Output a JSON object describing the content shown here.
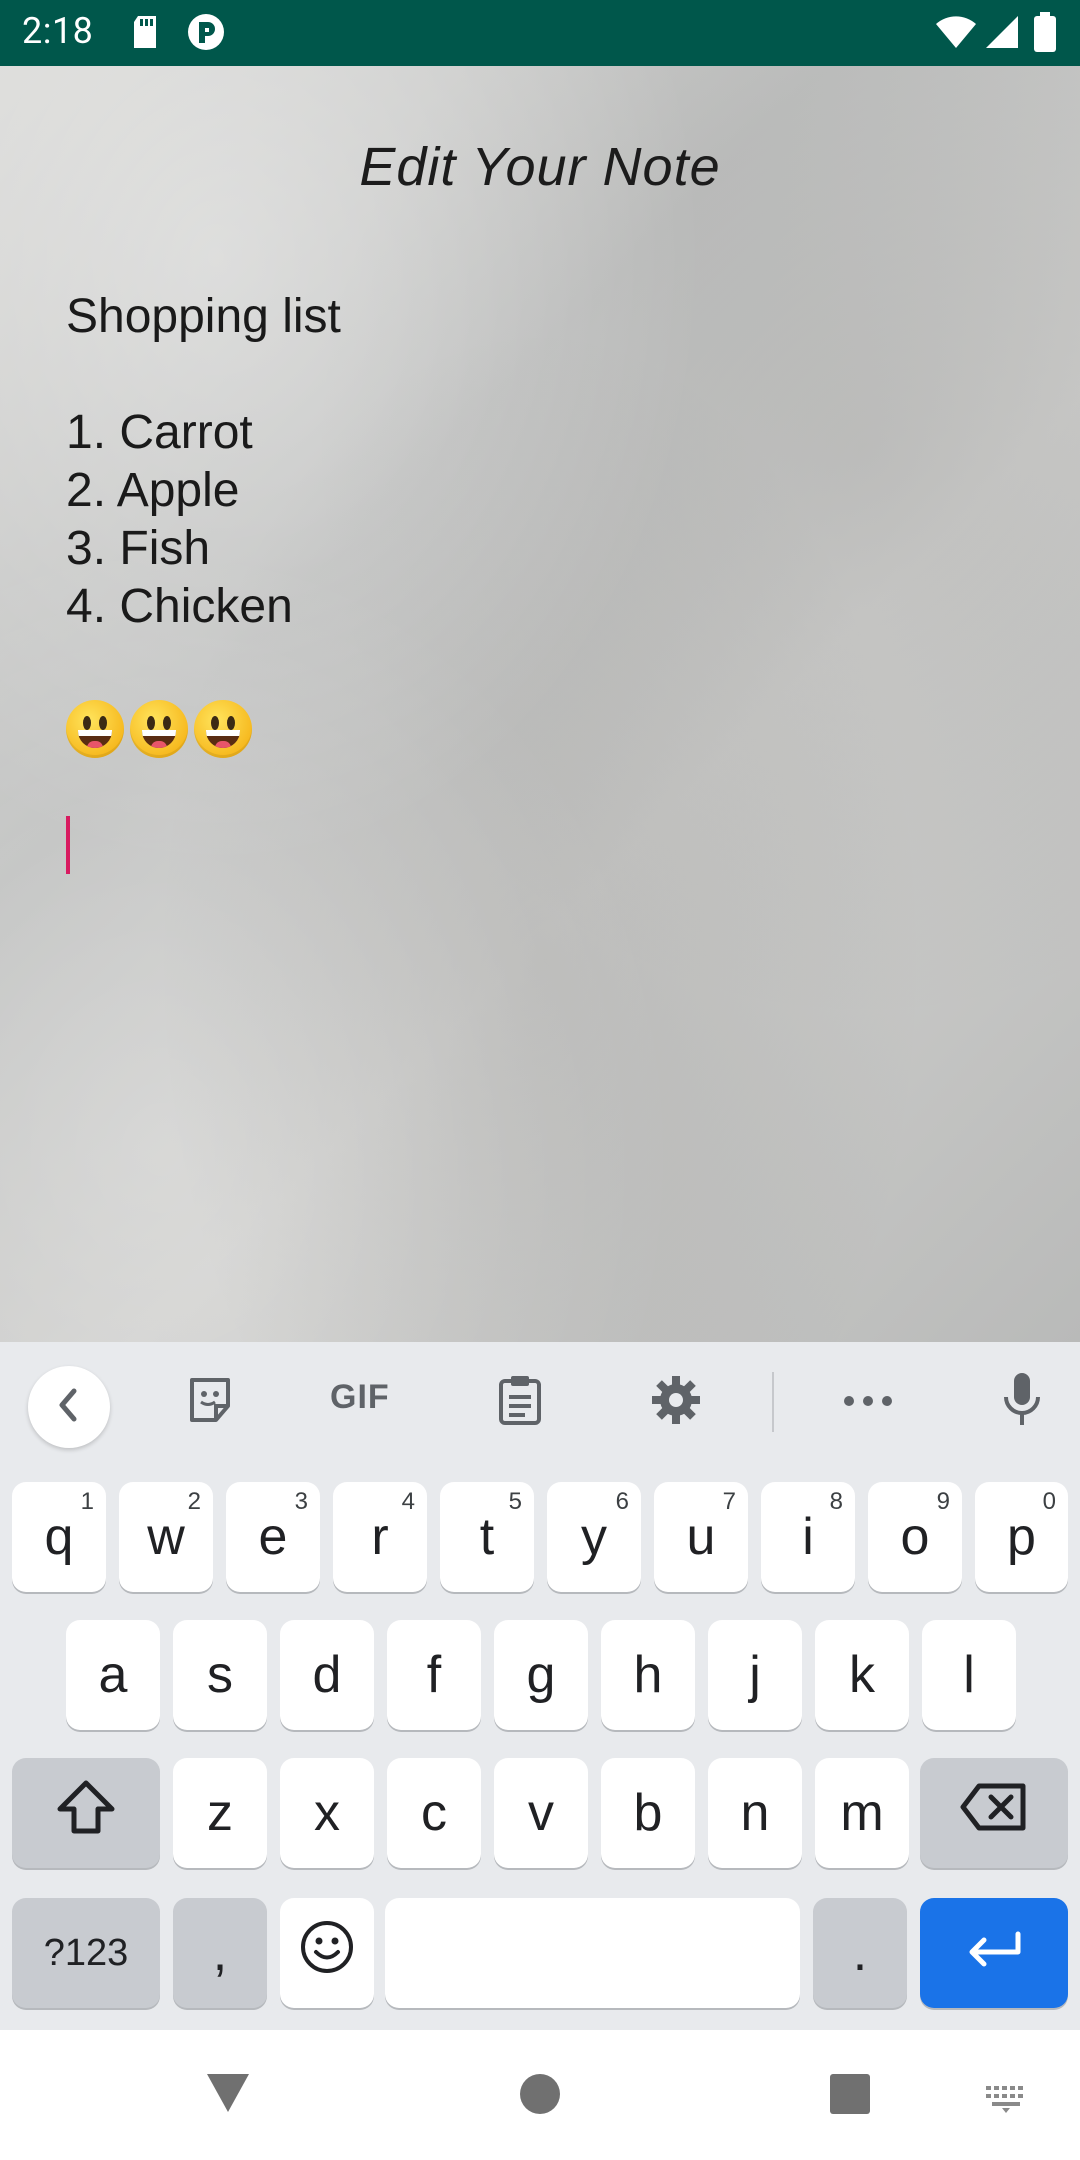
{
  "status_bar": {
    "time": "2:18",
    "icons": [
      "sd-card-icon",
      "vpn-icon",
      "wifi-icon",
      "signal-icon",
      "battery-icon"
    ]
  },
  "note": {
    "title": "Edit Your Note",
    "body": "Shopping list\n\n1. Carrot\n2. Apple\n3. Fish\n4. Chicken",
    "emojis": [
      "grinning-face",
      "grinning-face",
      "grinning-face"
    ],
    "cursor_color": "#d81b60"
  },
  "keyboard": {
    "toolbar": [
      "back-chevron-icon",
      "sticker-icon",
      "gif",
      "clipboard-icon",
      "settings-icon",
      "more-icon",
      "microphone-icon"
    ],
    "gif_label": "GIF",
    "row1": [
      {
        "k": "q",
        "h": "1"
      },
      {
        "k": "w",
        "h": "2"
      },
      {
        "k": "e",
        "h": "3"
      },
      {
        "k": "r",
        "h": "4"
      },
      {
        "k": "t",
        "h": "5"
      },
      {
        "k": "y",
        "h": "6"
      },
      {
        "k": "u",
        "h": "7"
      },
      {
        "k": "i",
        "h": "8"
      },
      {
        "k": "o",
        "h": "9"
      },
      {
        "k": "p",
        "h": "0"
      }
    ],
    "row2": [
      "a",
      "s",
      "d",
      "f",
      "g",
      "h",
      "j",
      "k",
      "l"
    ],
    "row3": [
      "z",
      "x",
      "c",
      "v",
      "b",
      "n",
      "m"
    ],
    "symbols_label": "?123",
    "comma_label": ",",
    "period_label": ".",
    "enter_color": "#1a73e8"
  },
  "nav_bar": {
    "buttons": [
      "back-icon",
      "home-icon",
      "recents-icon",
      "keyboard-switch-icon"
    ]
  }
}
